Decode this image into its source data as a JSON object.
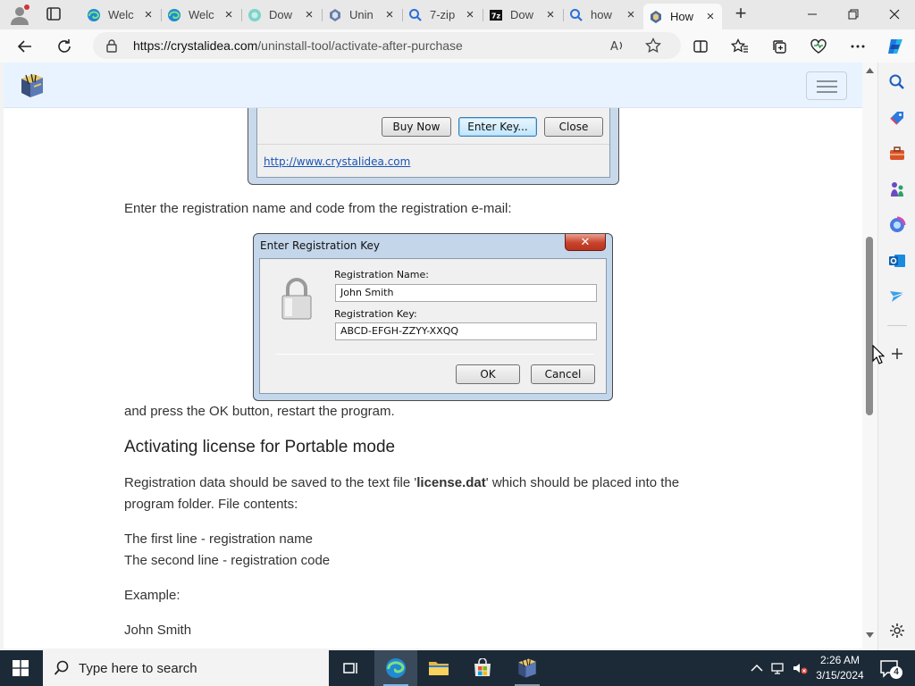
{
  "browser": {
    "tabs": [
      {
        "title": "Welc",
        "icon": "edge-icon"
      },
      {
        "title": "Welc",
        "icon": "edge-icon"
      },
      {
        "title": "Dow",
        "icon": "copilot-icon"
      },
      {
        "title": "Unin",
        "icon": "site-icon"
      },
      {
        "title": "7-zip",
        "icon": "search-icon"
      },
      {
        "title": "Dow",
        "icon": "7zip-icon"
      },
      {
        "title": "how",
        "icon": "search-icon"
      },
      {
        "title": "How",
        "icon": "crystalidea-icon",
        "active": true
      }
    ],
    "url_host": "https://crystalidea.com",
    "url_path": "/uninstall-tool/activate-after-purchase"
  },
  "page": {
    "dialog1": {
      "buttons": [
        "Buy Now",
        "Enter Key...",
        "Close"
      ],
      "link": "http://www.crystalidea.com"
    },
    "para1": "Enter the registration name and code from the registration e-mail:",
    "dialog2": {
      "title": "Enter Registration Key",
      "name_label": "Registration Name:",
      "name_value": "John Smith",
      "key_label": "Registration Key:",
      "key_value": "ABCD-EFGH-ZZYY-XXQQ",
      "ok": "OK",
      "cancel": "Cancel"
    },
    "para2": "and press the OK button, restart the program.",
    "heading": "Activating license for Portable mode",
    "para3_a": "Registration data should be saved to the text file '",
    "para3_bold": "license.dat",
    "para3_b": "' which should be placed into the",
    "para3_c": "program folder. File contents:",
    "line1": "The first line - registration name",
    "line2": "The second line - registration code",
    "example": "Example:",
    "example_name": "John Smith"
  },
  "taskbar": {
    "search_placeholder": "Type here to search",
    "time": "2:26 AM",
    "date": "3/15/2024",
    "notifications": "4"
  },
  "colors": {
    "accent": "#0067c0",
    "taskbar": "#1c2a38",
    "site_header": "#e8f3ff"
  }
}
